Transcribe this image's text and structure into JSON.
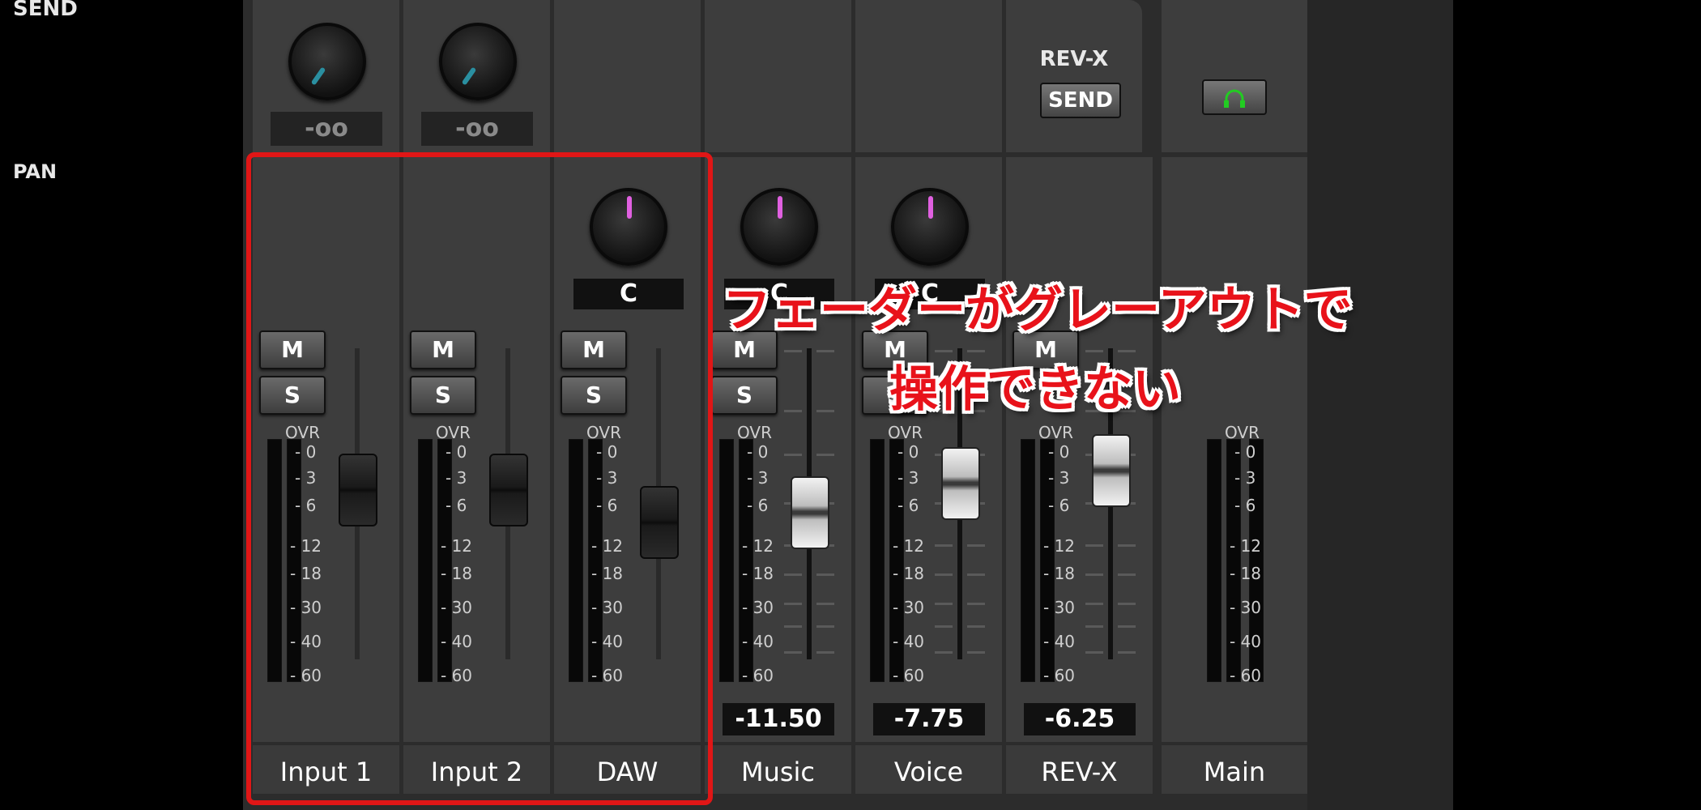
{
  "sections": {
    "send": "SEND",
    "pan": "PAN"
  },
  "channels": [
    {
      "name": "Input 1",
      "send_value": "-oo",
      "mute": "M",
      "solo": "S",
      "active": false
    },
    {
      "name": "Input 2",
      "send_value": "-oo",
      "mute": "M",
      "solo": "S",
      "active": false
    },
    {
      "name": "DAW",
      "pan_value": "C",
      "mute": "M",
      "solo": "S",
      "active": false
    },
    {
      "name": "Music",
      "pan_value": "C",
      "mute": "M",
      "solo": "S",
      "level": "-11.50",
      "active": true
    },
    {
      "name": "Voice",
      "pan_value": "C",
      "mute": "M",
      "solo": "S",
      "level": "-7.75",
      "active": true
    },
    {
      "name": "REV-X",
      "send_title": "REV-X",
      "send_button": "SEND",
      "mute": "M",
      "solo": "S",
      "level": "-6.25",
      "active": true
    },
    {
      "name": "Main",
      "active": true
    }
  ],
  "meter": {
    "ovr": "OVR",
    "scale": [
      "0",
      "3",
      "6",
      "12",
      "18",
      "30",
      "40",
      "60"
    ]
  },
  "annotation": {
    "line1": "フェーダーがグレーアウトで",
    "line2": "操作できない"
  },
  "colors": {
    "highlight": "#e01616",
    "pan_indicator": "#e060e0",
    "send_indicator": "#2a8fa0",
    "headphone_icon": "#22cc22"
  }
}
